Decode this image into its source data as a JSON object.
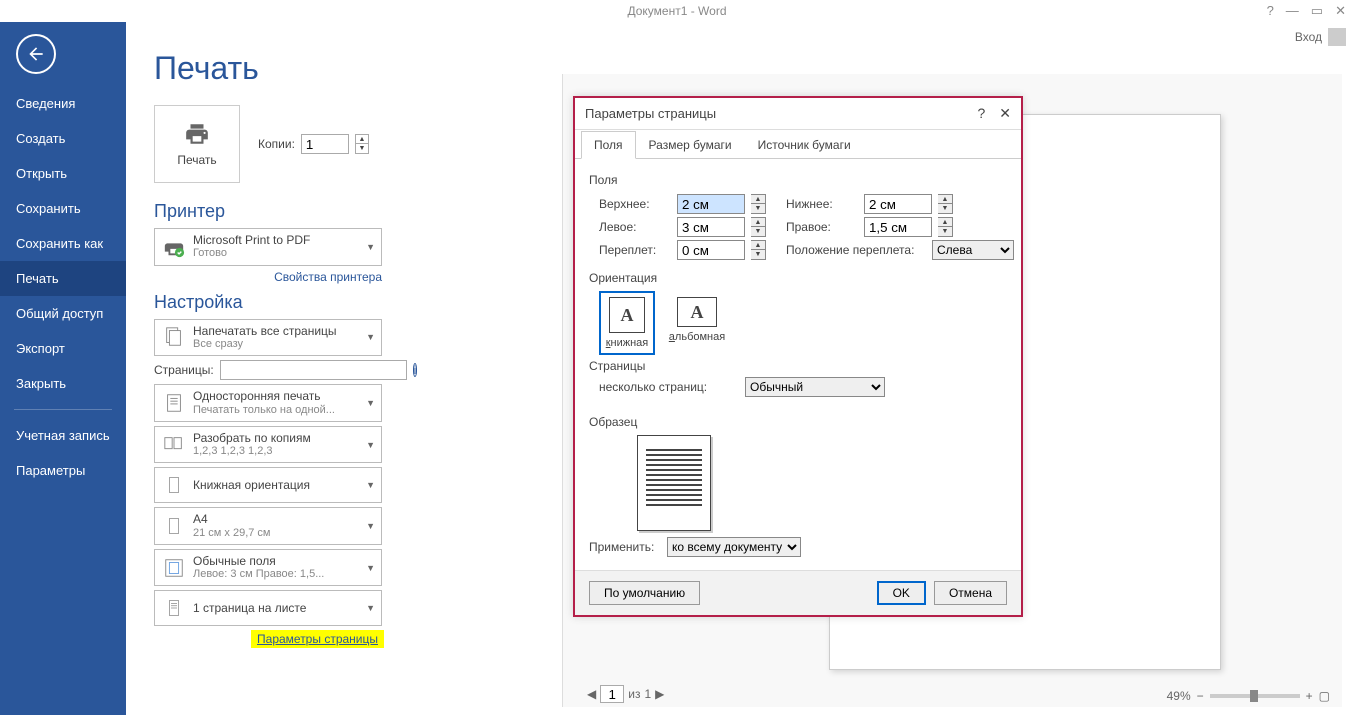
{
  "titlebar": {
    "title": "Документ1 - Word"
  },
  "account": {
    "label": "Вход"
  },
  "sidebar": {
    "items": [
      "Сведения",
      "Создать",
      "Открыть",
      "Сохранить",
      "Сохранить как",
      "Печать",
      "Общий доступ",
      "Экспорт",
      "Закрыть"
    ],
    "items2": [
      "Учетная запись",
      "Параметры"
    ],
    "active": 5
  },
  "page": {
    "title": "Печать",
    "print_label": "Печать",
    "copies_label": "Копии:",
    "copies_value": "1",
    "printer_title": "Принтер",
    "printer_name": "Microsoft Print to PDF",
    "printer_status": "Готово",
    "printer_props": "Свойства принтера",
    "settings_title": "Настройка",
    "opt_allpages": "Напечатать все страницы",
    "opt_allpages_sub": "Все сразу",
    "pages_label": "Страницы:",
    "opt_oneside": "Односторонняя печать",
    "opt_oneside_sub": "Печатать только на одной...",
    "opt_collate": "Разобрать по копиям",
    "opt_collate_sub": "1,2,3   1,2,3   1,2,3",
    "opt_orient": "Книжная ориентация",
    "opt_paper": "A4",
    "opt_paper_sub": "21 см x 29,7 см",
    "opt_margins": "Обычные поля",
    "opt_margins_sub": "Левое:  3 см   Правое:  1,5...",
    "opt_ppp": "1 страница на листе",
    "page_setup_link": "Параметры страницы"
  },
  "preview": {
    "page_current": "1",
    "page_sep": "из",
    "page_total": "1",
    "zoom": "49%"
  },
  "dialog": {
    "title": "Параметры страницы",
    "tabs": [
      "Поля",
      "Размер бумаги",
      "Источник бумаги"
    ],
    "margins_group": "Поля",
    "top_label": "Верхнее:",
    "top_val": "2 см",
    "bottom_label": "Нижнее:",
    "bottom_val": "2 см",
    "left_label": "Левое:",
    "left_val": "3 см",
    "right_label": "Правое:",
    "right_val": "1,5 см",
    "gutter_label": "Переплет:",
    "gutter_val": "0 см",
    "gutterpos_label": "Положение переплета:",
    "gutterpos_val": "Слева",
    "orient_group": "Ориентация",
    "orient_portrait": "книжная",
    "orient_landscape": "альбомная",
    "pages_group": "Страницы",
    "multipages_label": "несколько страниц:",
    "multipages_val": "Обычный",
    "sample_group": "Образец",
    "apply_label": "Применить:",
    "apply_val": "ко всему документу",
    "default_btn": "По умолчанию",
    "ok_btn": "OK",
    "cancel_btn": "Отмена"
  }
}
